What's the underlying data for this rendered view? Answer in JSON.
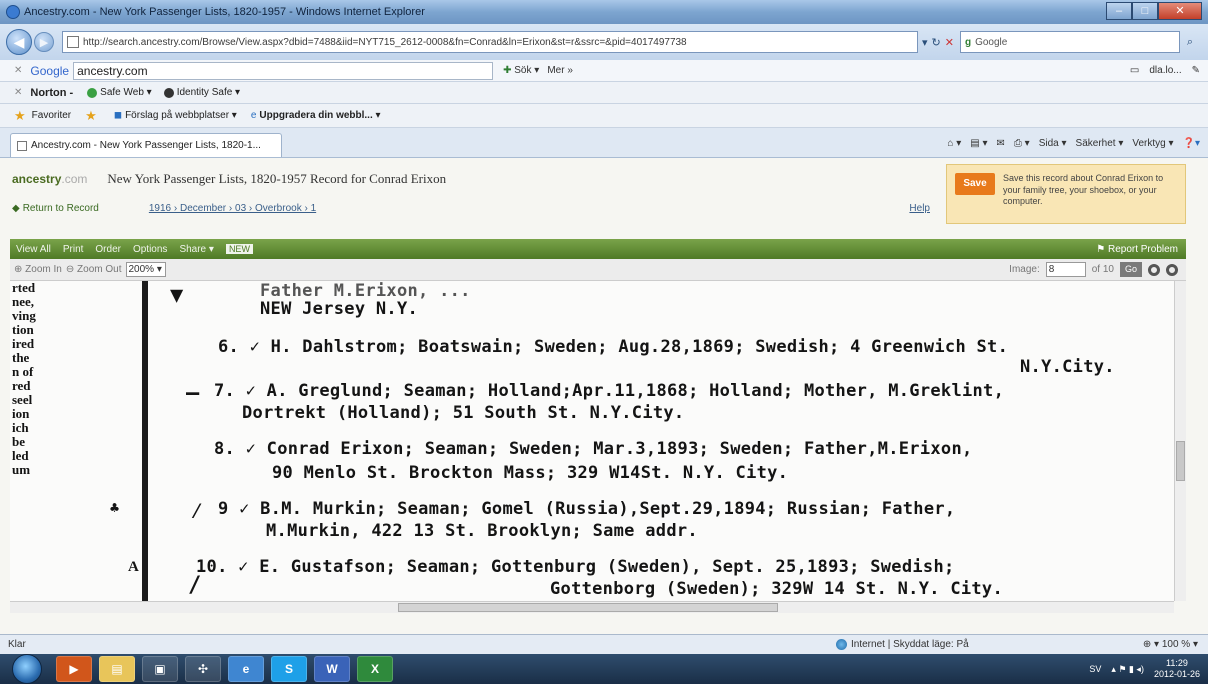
{
  "window": {
    "title": "Ancestry.com - New York Passenger Lists, 1820-1957 - Windows Internet Explorer"
  },
  "address": {
    "url": "http://search.ancestry.com/Browse/View.aspx?dbid=7488&iid=NYT715_2612-0008&fn=Conrad&ln=Erixon&st=r&ssrc=&pid=4017497738",
    "search_value": "Google"
  },
  "googlebar": {
    "logo": "Google",
    "query": "ancestry.com",
    "search_label": "Sök",
    "more_label": "Mer »",
    "signin_label": "dla.lo..."
  },
  "nortonbar": {
    "logo": "Norton -",
    "safe_web": "Safe Web ▾",
    "identity_safe": "Identity Safe ▾"
  },
  "favbar": {
    "favorites": "Favoriter",
    "suggested": "Förslag på webbplatser ▾",
    "upgrade": "Uppgradera din webbl... ▾"
  },
  "tab": {
    "label": "Ancestry.com - New York Passenger Lists, 1820-1..."
  },
  "cmdbar": {
    "page": "Sida ▾",
    "safety": "Säkerhet ▾",
    "tools": "Verktyg ▾"
  },
  "ancestry": {
    "logo_prefix": "ancestry",
    "logo_suffix": ".com",
    "record_title": "New York Passenger Lists, 1820-1957 Record for Conrad Erixon",
    "return_link": "Return to Record",
    "breadcrumb": "1916 › December › 03 › Overbrook › 1",
    "help": "Help",
    "save_button": "Save",
    "save_text": "Save this record about Conrad Erixon to your family tree, your shoebox, or your computer."
  },
  "viewer": {
    "view_all": "View All",
    "print": "Print",
    "order": "Order",
    "options": "Options",
    "share": "Share",
    "new_badge": "NEW",
    "report": "Report Problem",
    "zoom_in": "Zoom In",
    "zoom_out": "Zoom Out",
    "zoom_level": "200%",
    "image_label": "Image:",
    "image_number": "8",
    "image_total": "of 10",
    "go": "Go"
  },
  "document": {
    "left_col": [
      "rted",
      "nee,",
      "ving",
      "tion",
      "ired",
      "the",
      "n of",
      "red",
      "seel",
      "ion",
      "ich",
      "be",
      "led",
      "um"
    ],
    "lines": [
      "Father M.Erixon, ...",
      "NEW Jersey N.Y.",
      "6. ✓ H. Dahlstrom; Boatswain; Sweden; Aug.28,1869; Swedish; 4 Greenwich St.",
      "N.Y.City.",
      "7. ✓ A. Greglund; Seaman; Holland;Apr.11,1868; Holland; Mother, M.Greklint,",
      "Dortrekt (Holland); 51 South St. N.Y.City.",
      "8. ✓ Conrad Erixon; Seaman; Sweden; Mar.3,1893; Sweden; Father,M.Erixon,",
      "90 Menlo St. Brockton Mass; 329 W14St. N.Y. City.",
      "9 ✓ B.M. Murkin; Seaman; Gomel (Russia),Sept.29,1894; Russian; Father,",
      "M.Murkin, 422  13 St. Brooklyn;  Same addr.",
      "10. ✓ E. Gustafson; Seaman; Gottenburg (Sweden), Sept. 25,1893; Swedish;",
      "Gottenborg (Sweden);  329W 14 St. N.Y. City."
    ]
  },
  "status": {
    "left": "Klar",
    "zone": "Internet | Skyddat läge: På",
    "zoom": "100 %"
  },
  "taskbar": {
    "lang": "SV",
    "time": "11:29",
    "date": "2012-01-26"
  }
}
